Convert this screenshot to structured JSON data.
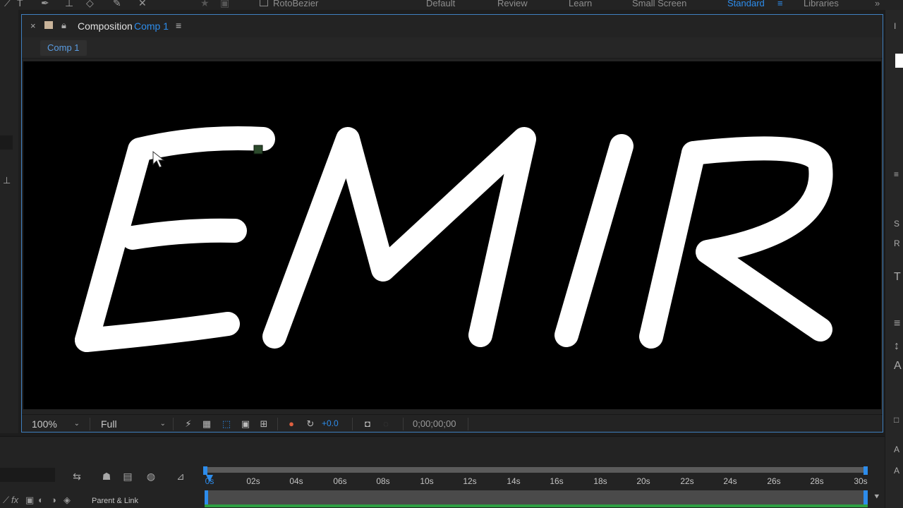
{
  "toolbar": {
    "rotobezier_label": "RotoBezier",
    "workspaces": [
      "Default",
      "Review",
      "Learn",
      "Small Screen",
      "Standard",
      "Libraries"
    ],
    "active_workspace": "Standard"
  },
  "comp_panel": {
    "title_prefix": "Composition",
    "title_comp": "Comp 1",
    "sub_tab": "Comp 1"
  },
  "viewer": {
    "artwork_text": "EMIR",
    "background": "#000000",
    "stroke_color": "#ffffff"
  },
  "viewer_footer": {
    "magnification": "100%",
    "resolution": "Full",
    "exposure": "+0.0",
    "timecode": "0;00;00;00"
  },
  "timeline": {
    "parent_link_label": "Parent & Link",
    "ticks": [
      "0s",
      "02s",
      "04s",
      "06s",
      "08s",
      "10s",
      "12s",
      "14s",
      "16s",
      "18s",
      "20s",
      "22s",
      "24s",
      "26s",
      "28s",
      "30s"
    ]
  },
  "colors": {
    "accent": "#2d8ceb",
    "panel_border": "#3f7fbf",
    "work_area_green": "#2ea043"
  }
}
